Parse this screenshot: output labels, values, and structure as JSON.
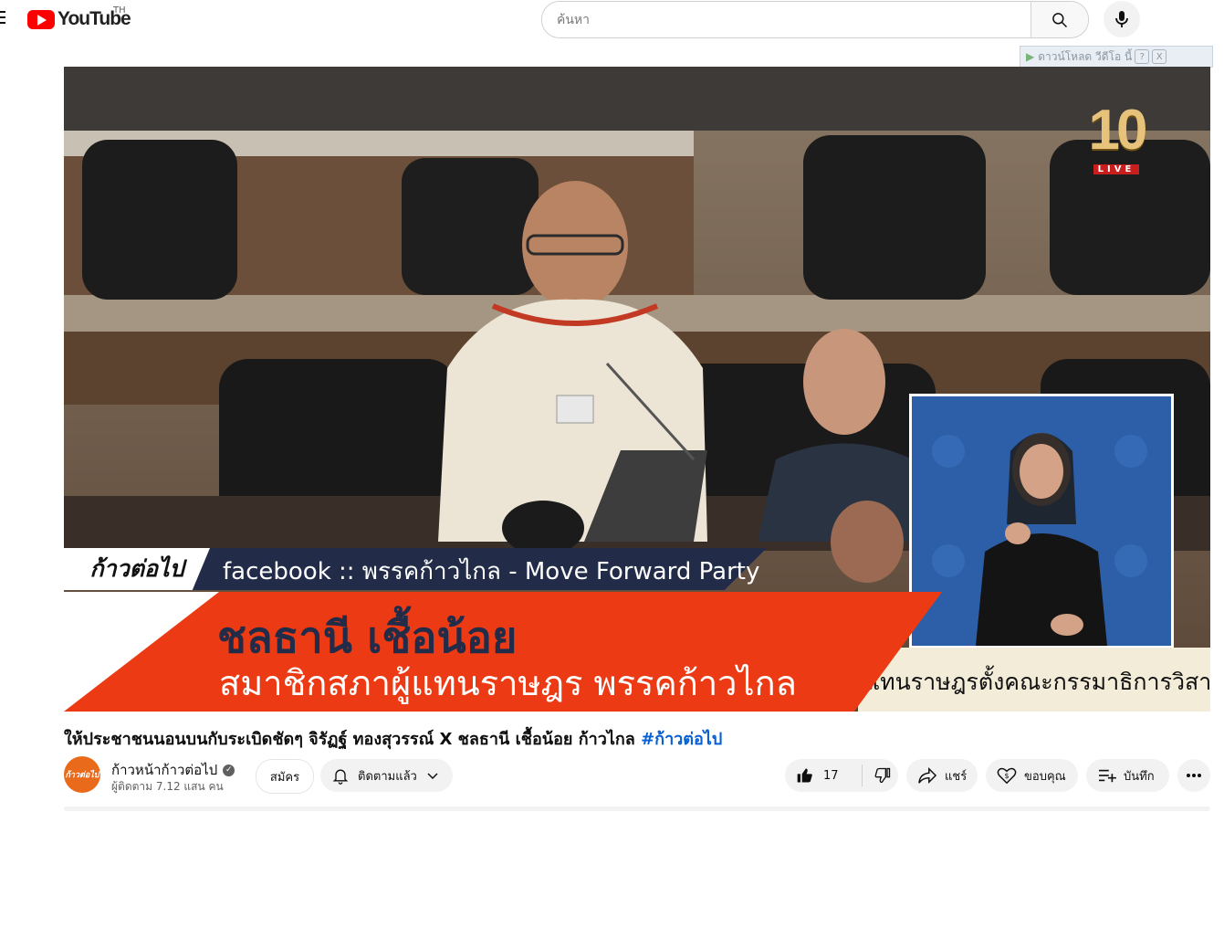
{
  "header": {
    "logo_text": "YouTube",
    "logo_region": "TH",
    "search_placeholder": "ค้นหา",
    "icons": [
      "menu-icon",
      "youtube-logo-icon",
      "search-icon",
      "mic-icon"
    ]
  },
  "download_bar": {
    "label": "ดาวน์โหลด วีดีโอ นี้",
    "help": "?",
    "close": "X"
  },
  "video": {
    "channel_badge": "10",
    "live_label": "LIVE",
    "show_badge": "ก้าวต่อไป",
    "facebook_line": "facebook :: พรรคก้าวไกล - Move Forward Party",
    "speaker_name": "ชลธานี เชื้อน้อย",
    "speaker_role": "สมาชิกสภาผู้แทนราษฎร พรรคก้าวไกล",
    "ticker_text": "แทนราษฎรตั้งคณะกรรมาธิการวิสา"
  },
  "info": {
    "title": "ให้ประชาชนนอนบนกับระเบิดชัดๆ จิรัฏฐ์ ทองสุวรรณ์ X ชลธานี เชื้อน้อย ก้าวไกล",
    "hashtag": "#ก้าวต่อไป",
    "channel_name": "ก้าวหน้าก้าวต่อไป",
    "avatar_text": "ก้าวต่อไป",
    "subscribers": "ผู้ติดตาม 7.12 แสน คน",
    "join_label": "สมัคร",
    "subscribed_label": "ติดตามแล้ว",
    "like_count": "17",
    "share_label": "แชร์",
    "thanks_label": "ขอบคุณ",
    "save_label": "บันทึก"
  },
  "colors": {
    "brand_red": "#ff0000",
    "link_blue": "#065fd4",
    "band_orange": "#ec3b14",
    "strip_navy": "#222c48"
  }
}
